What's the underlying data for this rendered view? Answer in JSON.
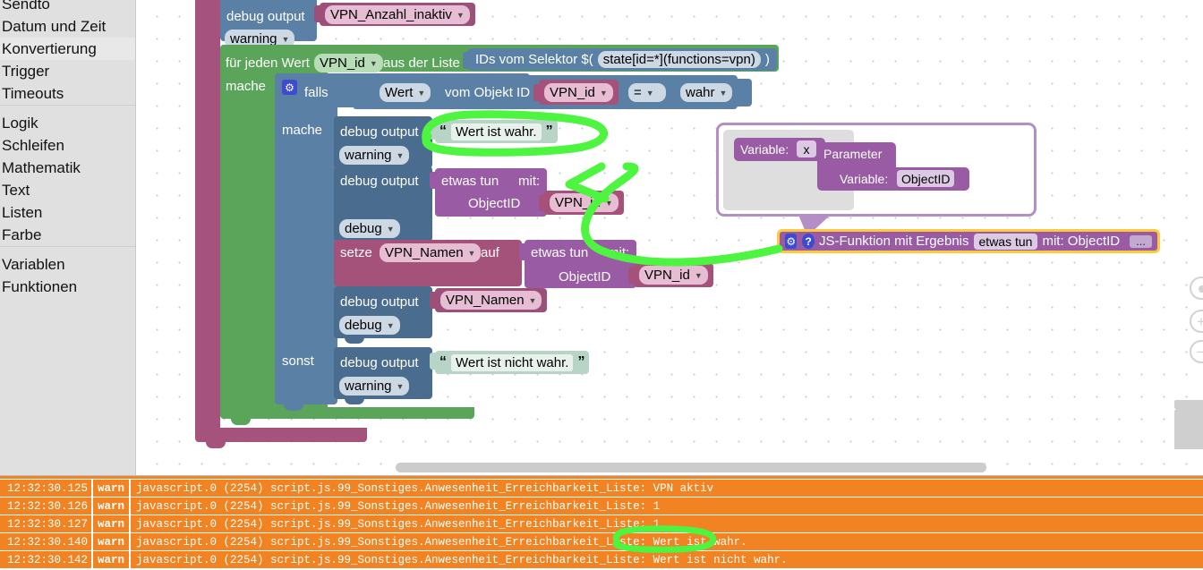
{
  "sidebar": {
    "items": [
      {
        "label": "Sendto",
        "highlight": false,
        "clipped": true
      },
      {
        "label": "Datum und Zeit",
        "highlight": false
      },
      {
        "label": "Konvertierung",
        "highlight": true
      },
      {
        "label": "Trigger",
        "highlight": false
      },
      {
        "label": "Timeouts",
        "highlight": false
      },
      {
        "label": "Logik",
        "highlight": false
      },
      {
        "label": "Schleifen",
        "highlight": false
      },
      {
        "label": "Mathematik",
        "highlight": false
      },
      {
        "label": "Text",
        "highlight": false
      },
      {
        "label": "Listen",
        "highlight": false
      },
      {
        "label": "Farbe",
        "highlight": false
      },
      {
        "label": "Variablen",
        "highlight": false
      },
      {
        "label": "Funktionen",
        "highlight": false
      }
    ]
  },
  "workspace": {
    "debug_top": {
      "label": "debug output",
      "value": "VPN_Anzahl_inaktiv",
      "severity": "warning"
    },
    "foreach": {
      "prefix": "für jeden Wert",
      "variable": "VPN_id",
      "middle": "aus der Liste",
      "do_label": "mache",
      "selector_prefix": "IDs vom Selektor $(",
      "selector_value": "state[id=*](functions=vpn)",
      "selector_suffix": ")"
    },
    "if_block": {
      "gear_icon": "gear-icon",
      "if_label": "falls",
      "do_label": "mache",
      "else_label": "sonst",
      "condition": {
        "field": "Wert",
        "middle": "vom Objekt ID",
        "objectid": "VPN_id",
        "operator": "=",
        "compare": "wahr"
      }
    },
    "then_blocks": {
      "debug1": {
        "label": "debug output",
        "text": "Wert ist wahr.",
        "quote_open": "“",
        "quote_close": "”",
        "severity": "warning"
      },
      "debug2": {
        "label": "debug output",
        "fn_label": "etwas tun",
        "fn_with": "mit:",
        "param_label": "ObjectID",
        "param_value": "VPN_id",
        "severity": "debug"
      },
      "setvar": {
        "label": "setze",
        "variable": "VPN_Namen",
        "to": "auf",
        "fn_label": "etwas tun",
        "fn_with": "mit:",
        "param_label": "ObjectID",
        "param_value": "VPN_id"
      },
      "debug3": {
        "label": "debug output",
        "value": "VPN_Namen",
        "severity": "debug"
      }
    },
    "else_blocks": {
      "debug4": {
        "label": "debug output",
        "text": "Wert ist nicht wahr.",
        "quote_open": "“",
        "quote_close": "”",
        "severity": "warning"
      }
    },
    "function_def": {
      "variable_label": "Variable:",
      "variable_name": "x",
      "parameter_label": "Parameter",
      "param_variable_label": "Variable:",
      "param_variable_name": "ObjectID"
    },
    "js_function": {
      "gear_icon": "gear-icon",
      "help_icon": "help-icon",
      "title": "JS-Funktion mit Ergebnis",
      "name": "etwas tun",
      "with_label": "mit: ObjectID",
      "mutator": "..."
    },
    "controls": {
      "zoom_reset": "zoom-reset-icon",
      "zoom_in": "+",
      "zoom_out": "−",
      "trash": "trash-icon"
    }
  },
  "log": {
    "columns": [
      "time",
      "severity",
      "message"
    ],
    "rows": [
      {
        "time": "12:32:30.125",
        "severity": "warn",
        "message": "javascript.0 (2254) script.js.99_Sonstiges.Anwesenheit_Erreichbarkeit_Liste: VPN aktiv"
      },
      {
        "time": "12:32:30.126",
        "severity": "warn",
        "message": "javascript.0 (2254) script.js.99_Sonstiges.Anwesenheit_Erreichbarkeit_Liste: 1"
      },
      {
        "time": "12:32:30.127",
        "severity": "warn",
        "message": "javascript.0 (2254) script.js.99_Sonstiges.Anwesenheit_Erreichbarkeit_Liste: 1"
      },
      {
        "time": "12:32:30.140",
        "severity": "warn",
        "message": "javascript.0 (2254) script.js.99_Sonstiges.Anwesenheit_Erreichbarkeit_Liste: Wert ist wahr."
      },
      {
        "time": "12:32:30.142",
        "severity": "warn",
        "message": "javascript.0 (2254) script.js.99_Sonstiges.Anwesenheit_Erreichbarkeit_Liste: Wert ist nicht wahr."
      }
    ]
  },
  "annotations": {
    "highlight_color": "#4df541",
    "marks": [
      "circle-wert-ist-wahr-block",
      "arrow-to-vpn-id",
      "circle-log-wert-ist-wahr"
    ]
  }
}
